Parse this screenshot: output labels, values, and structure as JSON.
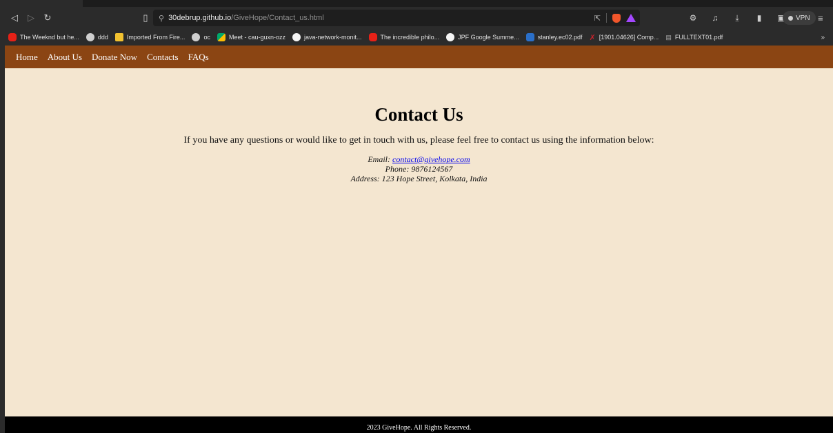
{
  "browser": {
    "url_host": "30debrup.github.io",
    "url_path": "/GiveHope/Contact_us.html",
    "vpn_label": "VPN",
    "bookmarks": [
      {
        "label": "The Weeknd but he...",
        "icon": "youtube-icon"
      },
      {
        "label": "ddd",
        "icon": "globe-icon"
      },
      {
        "label": "Imported From Fire...",
        "icon": "folder-icon"
      },
      {
        "label": "oc",
        "icon": "globe-icon"
      },
      {
        "label": "Meet - cau-guxn-ozz",
        "icon": "meet-icon"
      },
      {
        "label": "java-network-monit...",
        "icon": "github-icon"
      },
      {
        "label": "The incredible philo...",
        "icon": "youtube-icon"
      },
      {
        "label": "JPF Google Summe...",
        "icon": "github-icon"
      },
      {
        "label": "stanley.ec02.pdf",
        "icon": "ieee-icon"
      },
      {
        "label": "[1901.04626] Comp...",
        "icon": "arxiv-icon"
      },
      {
        "label": "FULLTEXT01.pdf",
        "icon": "pdf-icon"
      }
    ],
    "bookmarks_more": "»"
  },
  "site": {
    "nav": [
      "Home",
      "About Us",
      "Donate Now",
      "Contacts",
      "FAQs"
    ],
    "title": "Contact Us",
    "intro": "If you have any questions or would like to get in touch with us, please feel free to contact us using the information below:",
    "email_label": "Email: ",
    "email": "contact@givehope.com",
    "phone": "Phone: 9876124567",
    "address": "Address: 123 Hope Street, Kolkata, India",
    "footer": "2023 GiveHope. All Rights Reserved."
  }
}
